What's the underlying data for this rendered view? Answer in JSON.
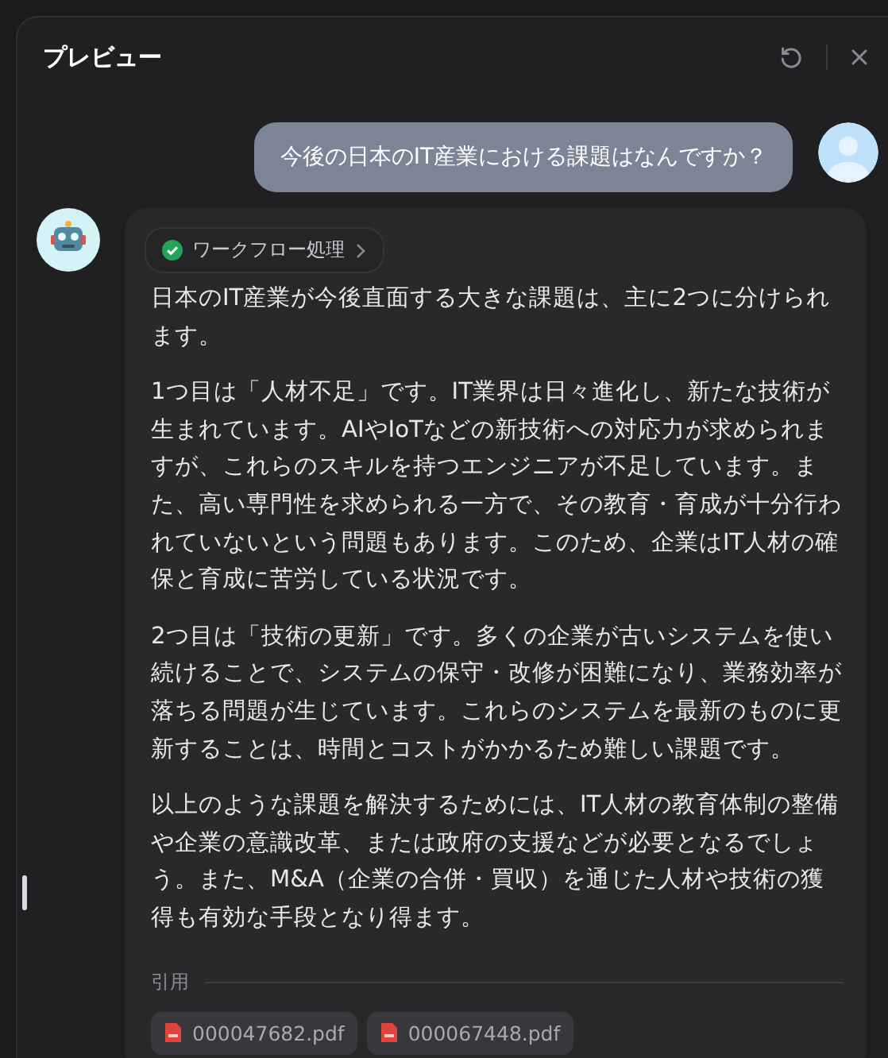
{
  "panel": {
    "title": "プレビュー"
  },
  "user_message": {
    "text": "今後の日本のIT産業における課題はなんですか？"
  },
  "answer": {
    "workflow": {
      "label": "ワークフロー処理",
      "done": true
    },
    "paragraphs": [
      "日本のIT産業が今後直面する大きな課題は、主に2つに分けられます。",
      "1つ目は「人材不足」です。IT業界は日々進化し、新たな技術が生まれています。AIやIoTなどの新技術への対応力が求められますが、これらのスキルを持つエンジニアが不足しています。また、高い専門性を求められる一方で、その教育・育成が十分行われていないという問題もあります。このため、企業はIT人材の確保と育成に苦労している状況です。",
      "2つ目は「技術の更新」です。多くの企業が古いシステムを使い続けることで、システムの保守・改修が困難になり、業務効率が落ちる問題が生じています。これらのシステムを最新のものに更新することは、時間とコストがかかるため難しい課題です。",
      "以上のような課題を解決するためには、IT人材の教育体制の整備や企業の意識改革、または政府の支援などが必要となるでしょう。また、M&A（企業の合併・買収）を通じた人材や技術の獲得も有効な手段となり得ます。"
    ],
    "citations": {
      "label": "引用",
      "files": [
        "000047682.pdf",
        "000067448.pdf"
      ]
    }
  }
}
